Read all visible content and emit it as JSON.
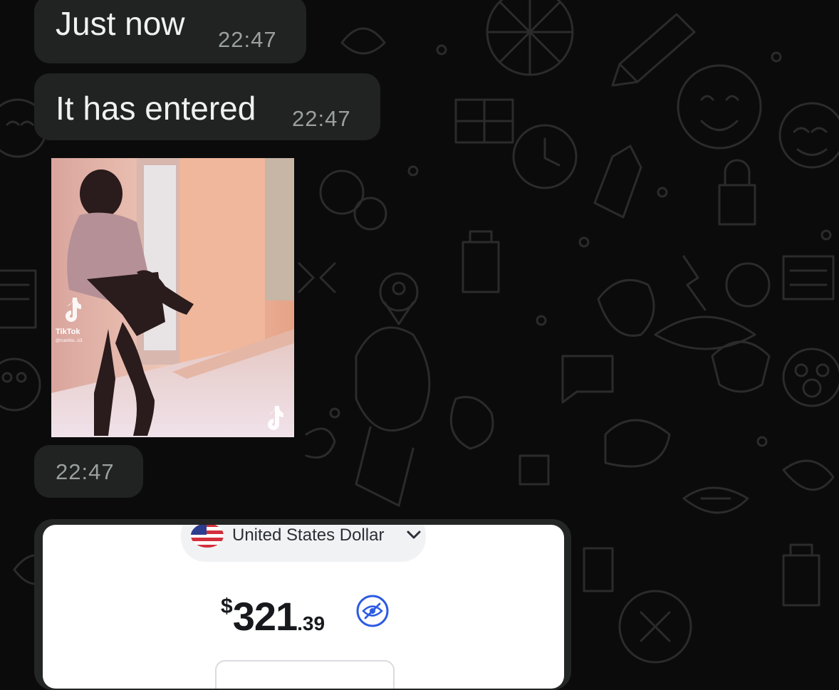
{
  "messages": [
    {
      "text": "Just now",
      "time": "22:47"
    },
    {
      "text": "It has entered",
      "time": "22:47"
    },
    {
      "time": "22:47"
    }
  ],
  "media": {
    "watermark_brand": "TikTok",
    "watermark_user": "@rcambo...k3"
  },
  "wallet": {
    "currency_label": "United States Dollar",
    "balance_symbol": "$",
    "balance_main": "321",
    "balance_cents": ".39",
    "icon": "eye-slash-icon",
    "accent": "#2d5be3"
  },
  "colors": {
    "background": "#0b0b0b",
    "bubble": "#202322",
    "timestamp": "#9aa09e"
  }
}
